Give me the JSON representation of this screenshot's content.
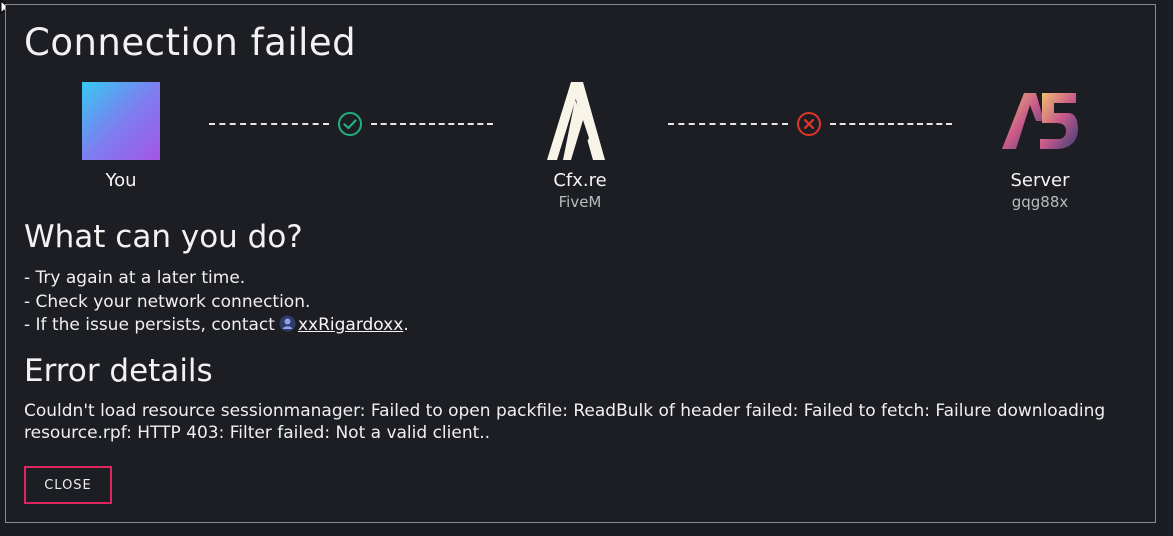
{
  "dialog": {
    "title": "Connection failed"
  },
  "connection": {
    "you": {
      "name": "You"
    },
    "platform": {
      "name": "Cfx.re",
      "sub": "FiveM"
    },
    "server": {
      "name": "Server",
      "sub": "gqg88x"
    },
    "link_client_platform": {
      "status": "success",
      "icon": "check-circle-icon",
      "color": "#1fb27a"
    },
    "link_platform_server": {
      "status": "failed",
      "icon": "x-circle-icon",
      "color": "#e0352b"
    }
  },
  "help": {
    "heading": "What can you do?",
    "items": [
      "- Try again at a later time.",
      "- Check your network connection.",
      "- If the issue persists, contact"
    ],
    "contact_name": "xxRigardoxx",
    "contact_suffix": "."
  },
  "error": {
    "heading": "Error details",
    "message": "Couldn't load resource sessionmanager: Failed to open packfile: ReadBulk of header failed: Failed to fetch: Failure downloading resource.rpf: HTTP 403: Filter failed: Not a valid client.."
  },
  "actions": {
    "close_label": "CLOSE"
  },
  "colors": {
    "background": "#1c1e23",
    "border": "#8a8c90",
    "accent": "#e0245e"
  }
}
